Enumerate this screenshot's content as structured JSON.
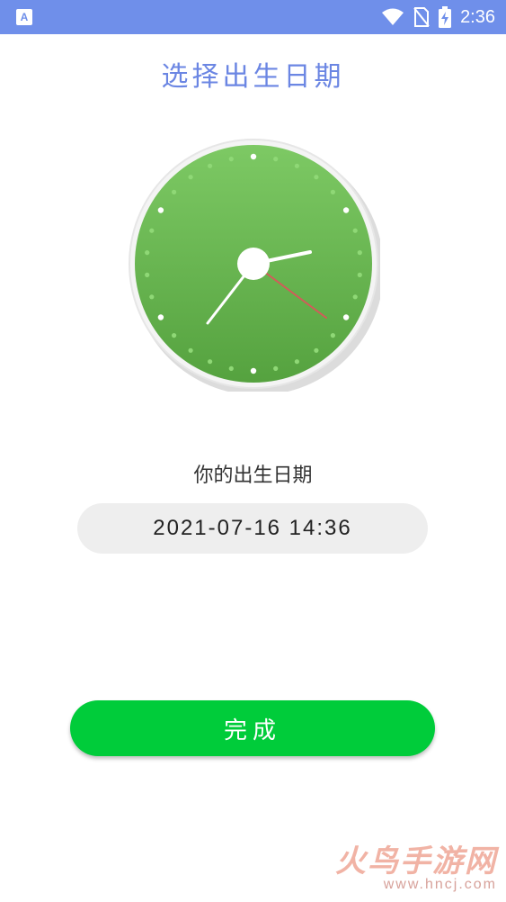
{
  "status_bar": {
    "app_icon_letter": "A",
    "icons": [
      "wifi-icon",
      "no-sim-icon",
      "battery-charging-icon"
    ],
    "time": "2:36"
  },
  "header": {
    "title": "选择出生日期"
  },
  "clock_widget": {
    "face_color": "#6ab64e",
    "hour_hand_time": "2:36"
  },
  "birth": {
    "label": "你的出生日期",
    "value": "2021-07-16 14:36"
  },
  "actions": {
    "done_label": "完成",
    "done_color": "#00cc3a"
  },
  "watermark": {
    "title": "火鸟手游网",
    "url": "www.hncj.com"
  }
}
